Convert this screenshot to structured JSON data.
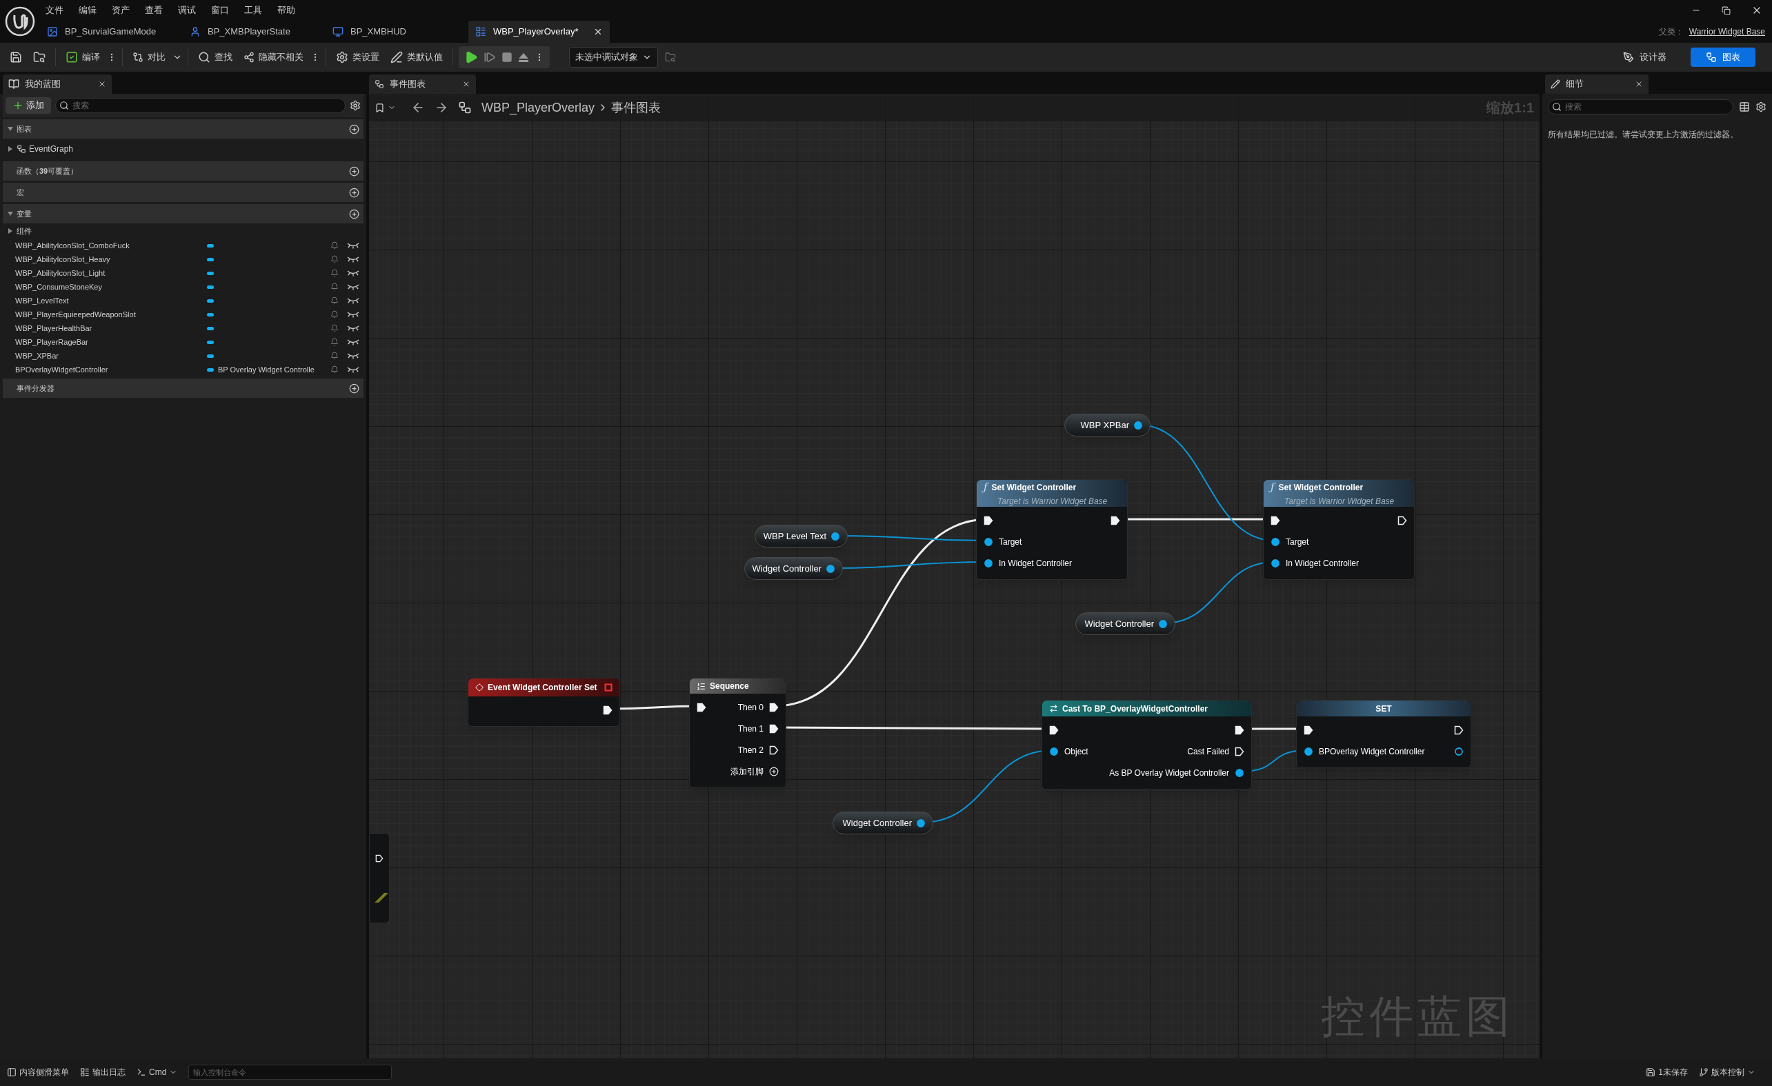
{
  "menu": [
    "文件",
    "编辑",
    "资产",
    "查看",
    "调试",
    "窗口",
    "工具",
    "帮助"
  ],
  "document_tabs": [
    {
      "label": "BP_SurvialGameMode",
      "kind": "game_mode",
      "selected": false
    },
    {
      "label": "BP_XMBPlayerState",
      "kind": "player_state",
      "selected": false
    },
    {
      "label": "BP_XMBHUD",
      "kind": "hud",
      "selected": false
    },
    {
      "label": "WBP_PlayerOverlay*",
      "kind": "widget",
      "selected": true
    }
  ],
  "parent_class": {
    "label": "父类：",
    "value": "Warrior Widget Base"
  },
  "toolbar": {
    "compile": "编译",
    "diff": "对比",
    "find": "查找",
    "hide_unrelated": "隐藏不相关",
    "class_settings": "类设置",
    "class_defaults": "类默认值",
    "debug_target": "未选中调试对象"
  },
  "mode_buttons": [
    {
      "label": "设计器",
      "kind": "designer",
      "selected": false
    },
    {
      "label": "图表",
      "kind": "graph",
      "selected": true
    }
  ],
  "my_blueprint": {
    "tab": "我的蓝图",
    "add_button": "添加",
    "search_placeholder": "搜索",
    "sections": [
      {
        "title": "图表",
        "expanded": true,
        "items": [
          {
            "label": "EventGraph",
            "kind": "graph",
            "expanded": false
          }
        ]
      },
      {
        "title": "函数（**39**可覆盖）"
      },
      {
        "title": "宏"
      },
      {
        "title": "变量",
        "expanded": true,
        "items": [
          {
            "label": "组件",
            "kind": "category",
            "expanded": false
          }
        ],
        "variables": [
          {
            "name": "WBP_AbilityIconSlot_ComboFuck"
          },
          {
            "name": "WBP_AbilityIconSlot_Heavy"
          },
          {
            "name": "WBP_AbilityIconSlot_Light"
          },
          {
            "name": "WBP_ConsumeStoneKey"
          },
          {
            "name": "WBP_LevelText"
          },
          {
            "name": "WBP_PlayerEquieepedWeaponSlot"
          },
          {
            "name": "WBP_PlayerHealthBar"
          },
          {
            "name": "WBP_PlayerRageBar"
          },
          {
            "name": "WBP_XPBar"
          },
          {
            "name": "BPOverlayWidgetController",
            "type": "BP Overlay Widget Controlle"
          }
        ]
      },
      {
        "title": "事件分发器"
      }
    ]
  },
  "graph": {
    "tab": "事件图表",
    "breadcrumb": [
      "WBP_PlayerOverlay",
      "事件图表"
    ],
    "zoom": "缩放1:1",
    "watermark": "控件蓝图",
    "nodes": [
      {
        "kind": "getter",
        "title": "WBP XPBar",
        "connected": true
      },
      {
        "kind": "function",
        "glyph": "ƒ",
        "title": "Set Widget Controller",
        "subtitle": "Target is Warrior Widget Base",
        "rows": [
          {
            "in": {
              "kind": "exec",
              "connected": true
            },
            "out": {
              "kind": "exec",
              "connected": true
            }
          },
          {
            "in": {
              "kind": "data",
              "label": "Target",
              "connected": true
            }
          },
          {
            "in": {
              "kind": "data",
              "label": "In Widget Controller",
              "connected": true
            }
          }
        ]
      },
      {
        "kind": "function",
        "glyph": "ƒ",
        "title": "Set Widget Controller",
        "subtitle": "Target is Warrior Widget Base",
        "rows": [
          {
            "in": {
              "kind": "exec",
              "connected": true
            },
            "out": {
              "kind": "exec",
              "connected": false
            }
          },
          {
            "in": {
              "kind": "data",
              "label": "Target",
              "connected": true
            }
          },
          {
            "in": {
              "kind": "data",
              "label": "In Widget Controller",
              "connected": true
            }
          }
        ]
      },
      {
        "kind": "getter",
        "title": "WBP Level Text",
        "connected": true
      },
      {
        "kind": "getter",
        "title": "Widget Controller",
        "connected": true
      },
      {
        "kind": "getter",
        "title": "Widget Controller",
        "connected": true
      },
      {
        "kind": "event",
        "title": "Event Widget Controller Set",
        "rows": [
          {
            "out": {
              "kind": "exec",
              "connected": true
            }
          }
        ]
      },
      {
        "kind": "sequence",
        "title": "Sequence",
        "rows": [
          {
            "in": {
              "kind": "exec",
              "connected": true
            },
            "out": {
              "kind": "exec",
              "label": "Then 0",
              "connected": true
            }
          },
          {
            "out": {
              "kind": "exec",
              "label": "Then 1",
              "connected": true
            }
          },
          {
            "out": {
              "kind": "exec",
              "label": "Then 2",
              "connected": false
            }
          },
          {
            "out": {
              "kind": "add",
              "label": "添加引脚"
            }
          }
        ]
      },
      {
        "kind": "cast",
        "title": "Cast To BP_OverlayWidgetController",
        "rows": [
          {
            "in": {
              "kind": "exec",
              "connected": true
            },
            "out": {
              "kind": "exec",
              "connected": true
            }
          },
          {
            "in": {
              "kind": "data",
              "label": "Object",
              "connected": true
            },
            "out": {
              "kind": "exec",
              "label": "Cast Failed",
              "connected": false
            }
          },
          {
            "out": {
              "kind": "data",
              "label": "As BP Overlay Widget Controller",
              "connected": true
            }
          }
        ]
      },
      {
        "kind": "set",
        "title": "SET",
        "rows": [
          {
            "in": {
              "kind": "exec",
              "connected": true
            },
            "out": {
              "kind": "exec",
              "connected": false
            }
          },
          {
            "in": {
              "kind": "data",
              "label": "BPOverlay Widget Controller",
              "connected": true
            },
            "out": {
              "kind": "data",
              "connected": false
            }
          }
        ]
      },
      {
        "kind": "getter",
        "title": "Widget Controller",
        "connected": true
      }
    ]
  },
  "details": {
    "tab": "细节",
    "search_placeholder": "搜索",
    "message": "所有结果均已过滤。请尝试变更上方激活的过滤器。"
  },
  "status_bar": {
    "content_drawer": "内容侧滑菜单",
    "output_log": "输出日志",
    "cmd": "Cmd",
    "console_placeholder": "输入控制台命令",
    "unsaved": "1未保存",
    "source_control": "版本控制"
  }
}
